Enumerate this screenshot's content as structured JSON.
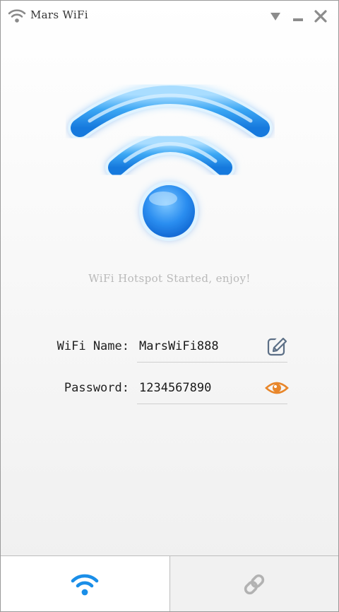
{
  "window": {
    "title": "Mars WiFi",
    "icons": {
      "app": "wifi-icon",
      "dropdown": "triangle-down-icon",
      "minimize": "minimize-icon",
      "close": "close-icon"
    }
  },
  "hero": {
    "icon": "wifi-large-icon",
    "status_text": "WiFi Hotspot Started, enjoy!"
  },
  "fields": {
    "wifi_name": {
      "label": "WiFi Name:",
      "value": "MarsWiFi888",
      "action_icon": "edit-icon"
    },
    "password": {
      "label": "Password:",
      "value": "1234567890",
      "action_icon": "eye-icon"
    }
  },
  "tabs": [
    {
      "icon": "wifi-icon",
      "active": true
    },
    {
      "icon": "link-icon",
      "active": false
    }
  ],
  "colors": {
    "accent_blue": "#1a8ee8",
    "eye_orange": "#e8862a",
    "status_gray": "#b9b9b9"
  }
}
